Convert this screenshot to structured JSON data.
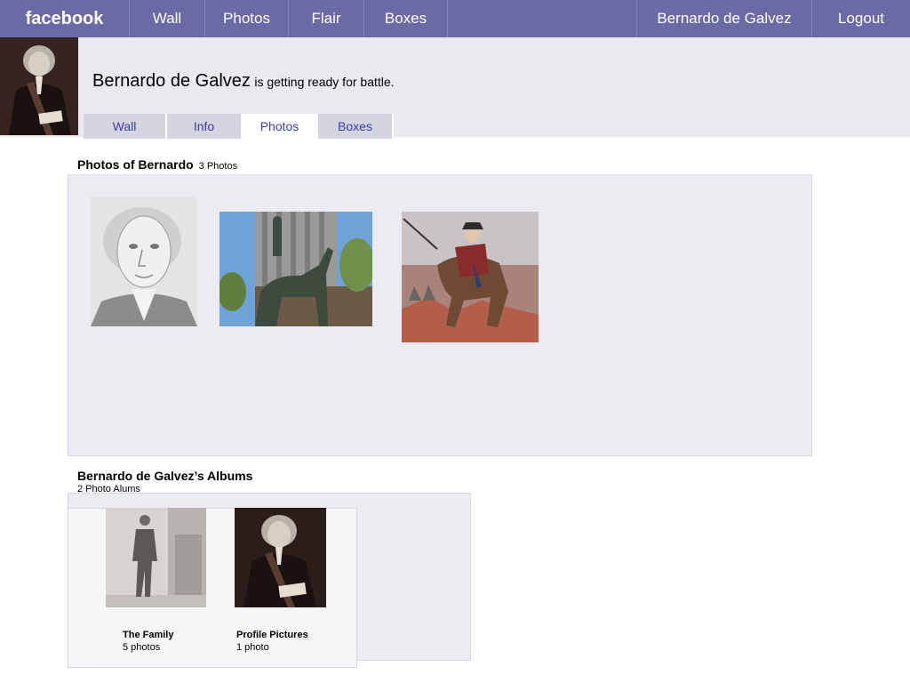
{
  "nav": {
    "logo": "facebook",
    "items": [
      "Wall",
      "Photos",
      "Flair",
      "Boxes"
    ],
    "user": "Bernardo de Galvez",
    "logout": "Logout"
  },
  "profile": {
    "name": "Bernardo de Galvez",
    "status": "is getting ready for battle.",
    "tabs": [
      {
        "label": "Wall",
        "active": false
      },
      {
        "label": "Info",
        "active": false
      },
      {
        "label": "Photos",
        "active": true
      },
      {
        "label": "Boxes",
        "active": false
      }
    ]
  },
  "photos": {
    "title": "Photos of Bernardo",
    "count": "3 Photos",
    "items": [
      {
        "name": "portrait-sketch-photo"
      },
      {
        "name": "equestrian-statue-photo"
      },
      {
        "name": "horseback-painting-photo"
      }
    ]
  },
  "albums": {
    "title": "Bernardo de Galvez’s Albums",
    "count": "2 Photo Alums",
    "items": [
      {
        "title": "The Family",
        "count": "5 photos"
      },
      {
        "title": "Profile Pictures",
        "count": "1 photo"
      }
    ]
  },
  "colors": {
    "nav_bg": "#6a6aa6",
    "band_bg": "#e9e9f0",
    "panel_bg": "#ebebf1",
    "tab_text": "#3b3bb0"
  }
}
